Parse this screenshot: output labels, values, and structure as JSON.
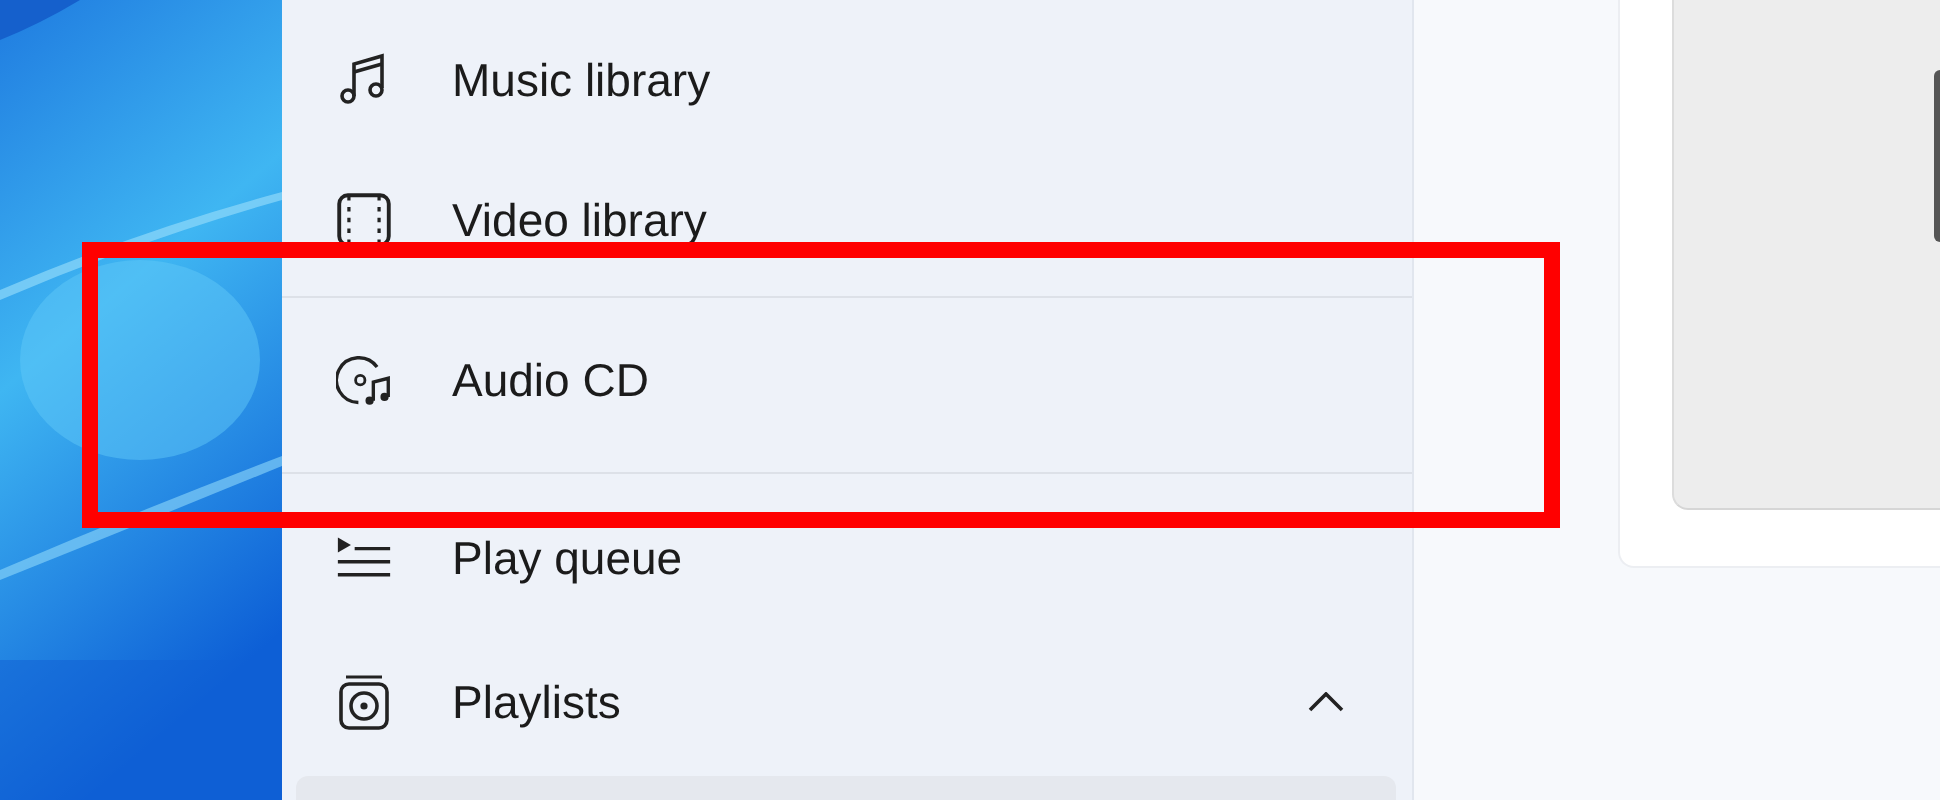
{
  "sidebar": {
    "groups": [
      {
        "items": [
          {
            "label": "Music library"
          },
          {
            "label": "Video library"
          }
        ]
      },
      {
        "items": [
          {
            "label": "Audio CD"
          }
        ]
      },
      {
        "items": [
          {
            "label": "Play queue"
          },
          {
            "label": "Playlists",
            "expanded": true
          }
        ]
      }
    ]
  },
  "annotation": {
    "kind": "rectangle"
  }
}
